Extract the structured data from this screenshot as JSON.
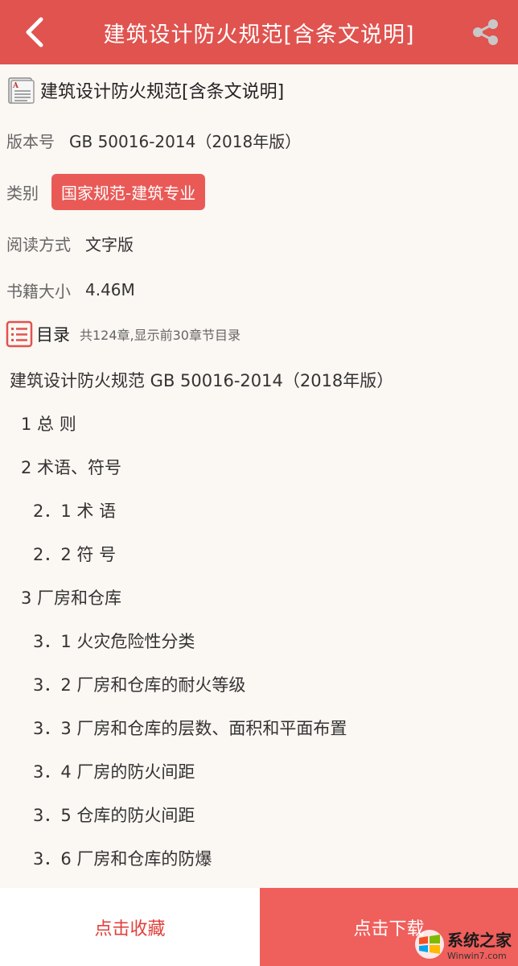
{
  "header": {
    "title": "建筑设计防火规范[含条文说明]",
    "back_icon": "chevron-left-icon",
    "share_icon": "share-icon"
  },
  "book": {
    "title": "建筑设计防火规范[含条文说明]",
    "icon": "document-icon"
  },
  "info": {
    "version_label": "版本号",
    "version_value": "GB 50016-2014（2018年版）",
    "category_label": "类别",
    "category_value": "国家规范-建筑专业",
    "read_label": "阅读方式",
    "read_value": "文字版",
    "size_label": "书籍大小",
    "size_value": "4.46M"
  },
  "toc": {
    "title": "目录",
    "note": "共124章,显示前30章节目录",
    "items": [
      {
        "text": "建筑设计防火规范 GB 50016-2014（2018年版）",
        "level": 0
      },
      {
        "text": "1 总 则",
        "level": 1
      },
      {
        "text": "2 术语、符号",
        "level": 1
      },
      {
        "text": "2．1 术 语",
        "level": 2
      },
      {
        "text": "2．2 符 号",
        "level": 2
      },
      {
        "text": "3 厂房和仓库",
        "level": 1
      },
      {
        "text": "3．1 火灾危险性分类",
        "level": 2
      },
      {
        "text": "3．2 厂房和仓库的耐火等级",
        "level": 2
      },
      {
        "text": "3．3 厂房和仓库的层数、面积和平面布置",
        "level": 2
      },
      {
        "text": "3．4 厂房的防火间距",
        "level": 2
      },
      {
        "text": "3．5 仓库的防火间距",
        "level": 2
      },
      {
        "text": "3．6 厂房和仓库的防爆",
        "level": 2
      }
    ]
  },
  "bottom": {
    "favorite_label": "点击收藏",
    "download_label": "点击下载"
  },
  "watermark": {
    "main": "系统之家",
    "sub": "Winwin7.com"
  },
  "colors": {
    "brand": "#e0534f",
    "download_bg": "#ef5f5c",
    "badge": "#e95a57",
    "favorite_text": "#e0413c"
  }
}
